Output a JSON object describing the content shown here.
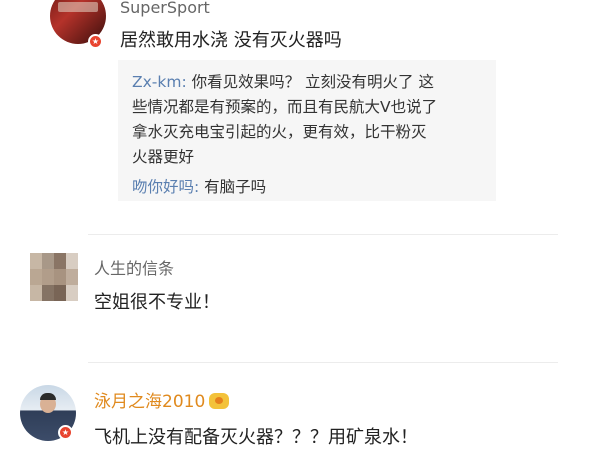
{
  "comments": [
    {
      "username": "SuperSport",
      "text": "居然敢用水浇 没有灭火器吗",
      "replies": {
        "line1_name": "Zx-km:",
        "line1_text": " 你看见效果吗？ 立刻没有明火了 这",
        "line2": "些情况都是有预案的，而且有民航大V也说了",
        "line3": "拿水灭充电宝引起的火，更有效，比干粉灭",
        "line4": "火器更好",
        "line5_name": "吻你好吗:",
        "line5_text": " 有脑子吗"
      }
    },
    {
      "username": "人生的信条",
      "text": "空姐很不专业！"
    },
    {
      "username": "泳月之海2010",
      "text": "飞机上没有配备灭火器？？？用矿泉水！"
    }
  ],
  "colors": {
    "link_blue": "#5a7fb0",
    "member_gold": "#e08a1e",
    "verified_red": "#e8442f"
  },
  "icons": [
    "verified-badge-icon",
    "member-crown-icon"
  ]
}
